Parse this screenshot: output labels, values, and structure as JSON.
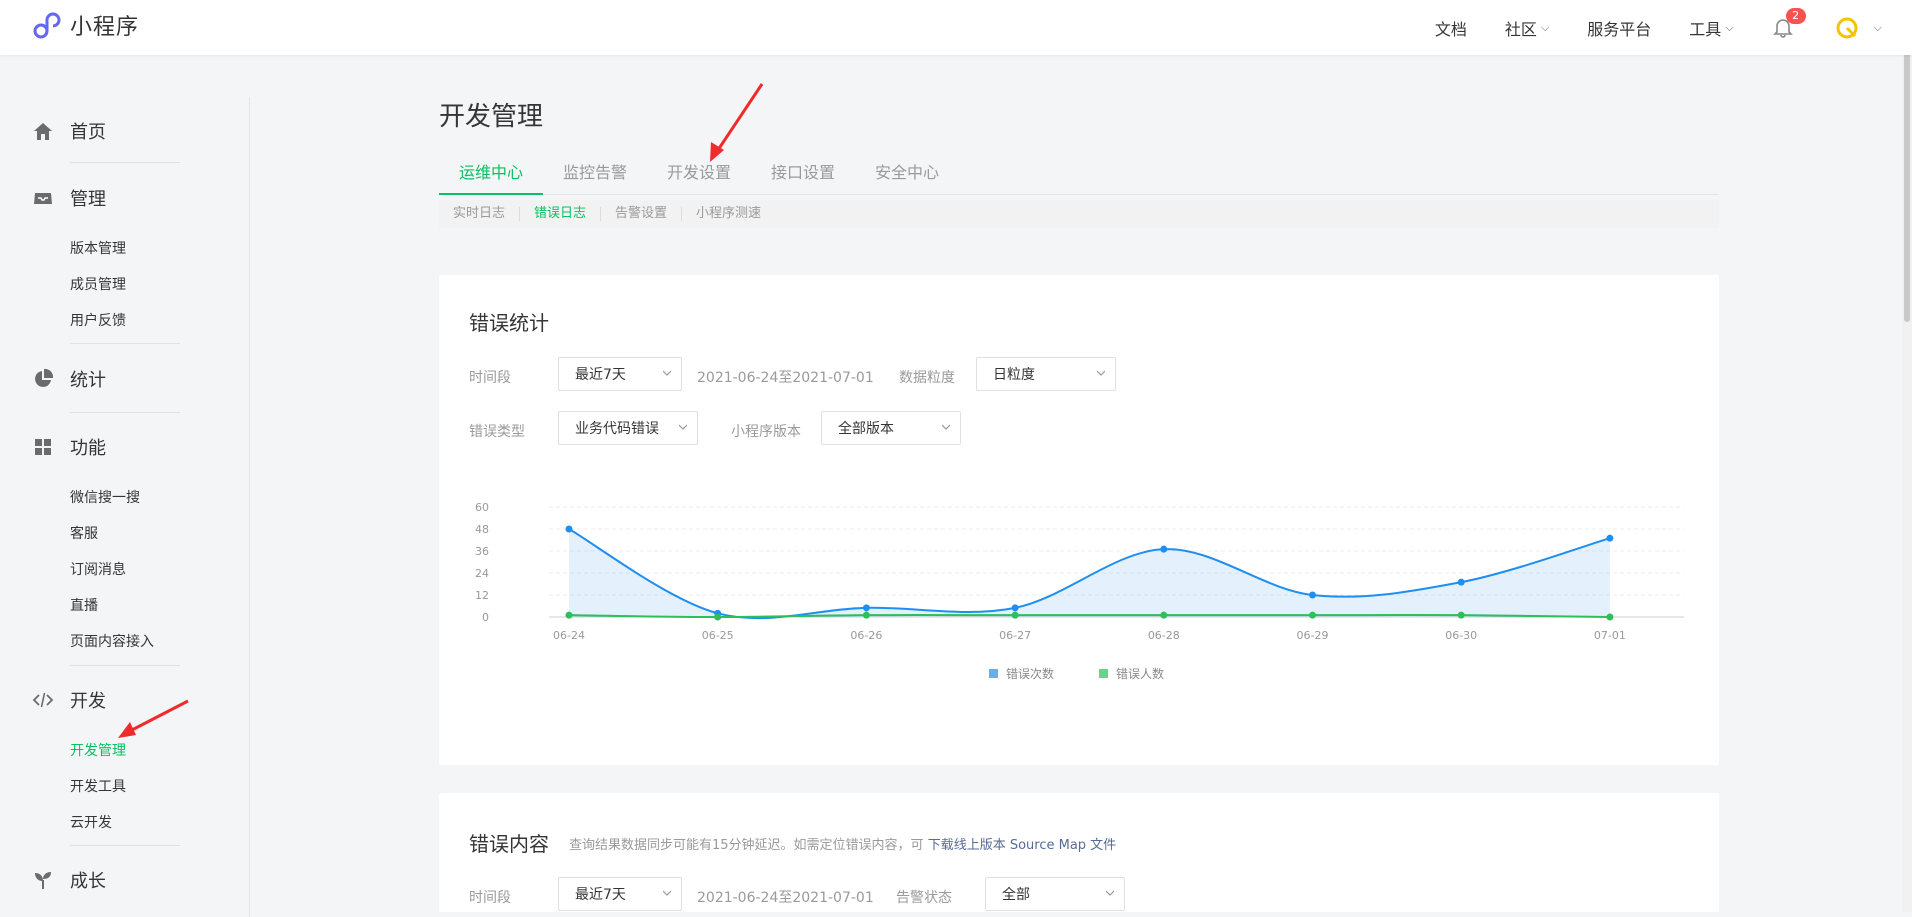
{
  "app": {
    "name": "小程序"
  },
  "topnav": {
    "docs": "文档",
    "community": "社区",
    "service": "服务平台",
    "tools": "工具",
    "notification_count": "2"
  },
  "sidebar": {
    "home": "首页",
    "manage": "管理",
    "manage_items": [
      "版本管理",
      "成员管理",
      "用户反馈"
    ],
    "stats": "统计",
    "features": "功能",
    "feature_items": [
      "微信搜一搜",
      "客服",
      "订阅消息",
      "直播",
      "页面内容接入"
    ],
    "dev": "开发",
    "dev_items": [
      "开发管理",
      "开发工具",
      "云开发"
    ],
    "growth": "成长"
  },
  "page": {
    "title": "开发管理",
    "tabs": [
      "运维中心",
      "监控告警",
      "开发设置",
      "接口设置",
      "安全中心"
    ],
    "subtabs": [
      "实时日志",
      "错误日志",
      "告警设置",
      "小程序测速"
    ]
  },
  "error_stats": {
    "title": "错误统计",
    "time_label": "时间段",
    "time_value": "最近7天",
    "range": "2021-06-24至2021-07-01",
    "granularity_label": "数据粒度",
    "granularity_value": "日粒度",
    "type_label": "错误类型",
    "type_value": "业务代码错误",
    "version_label": "小程序版本",
    "version_value": "全部版本"
  },
  "error_content": {
    "title": "错误内容",
    "note": "查询结果数据同步可能有15分钟延迟。如需定位错误内容，可",
    "link": "下载线上版本 Source Map 文件",
    "time_label": "时间段",
    "time_value": "最近7天",
    "range": "2021-06-24至2021-07-01",
    "alert_label": "告警状态",
    "alert_value": "全部"
  },
  "colors": {
    "accent": "#07c160",
    "series_count": "#1e8ff0",
    "series_users": "#2cbf5b"
  },
  "chart_data": {
    "type": "area",
    "x": [
      "06-24",
      "06-25",
      "06-26",
      "06-27",
      "06-28",
      "06-29",
      "06-30",
      "07-01"
    ],
    "ylim": [
      0,
      60
    ],
    "yticks": [
      0,
      12,
      24,
      36,
      48,
      60
    ],
    "series": [
      {
        "name": "错误次数",
        "values": [
          48,
          2,
          5,
          5,
          37,
          12,
          19,
          43
        ]
      },
      {
        "name": "错误人数",
        "values": [
          1,
          0,
          1,
          1,
          1,
          1,
          1,
          0
        ]
      }
    ],
    "legend": "bottom",
    "grid": true
  }
}
